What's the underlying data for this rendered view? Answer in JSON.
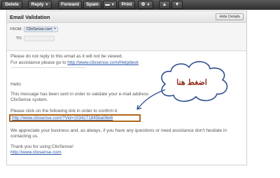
{
  "toolbar": {
    "delete_label": "Delete",
    "reply_label": "Reply",
    "forward_label": "Forward",
    "spam_label": "Spam",
    "move_label": "",
    "print_label": "Print",
    "actions_label": "",
    "prev_label": "▲",
    "next_label": "▼"
  },
  "email": {
    "subject": "Email Validation",
    "hide_details_label": "Hide Details",
    "from_label": "FROM:",
    "from_value": "ClixSense.com",
    "add_contact": "+",
    "to_label": "TO:",
    "lines": {
      "no_reply": "Please do not reply to this email as it will not be viewed.",
      "assistance_prefix": "For assistance please go to ",
      "helpdesk_link": "http://www.clixsense.com/Helpdesk",
      "dashes": "----------------------------------------------------------------",
      "hello": "Hello",
      "validate_line1": "This message has been sent in order to validate your e-mail address",
      "validate_line2": "ClixSense system.",
      "click_link": "Please click on the following link in order to confirm it:",
      "confirm_link": "http://www.clixsense.com/?Vid=1034271845ba06e6",
      "appreciate_line1": "We appreciate your business and, as always, if you have any questions or need assistance don't hesitate in",
      "appreciate_line2": "contacting us.",
      "thanks": "Thank you for using ClixSense!",
      "site_link": "http://www.clixsense.com"
    }
  },
  "annotation": {
    "callout_text": "اضغط هنا",
    "border_color": "#b0671c",
    "text_color": "#8e2c1a"
  }
}
